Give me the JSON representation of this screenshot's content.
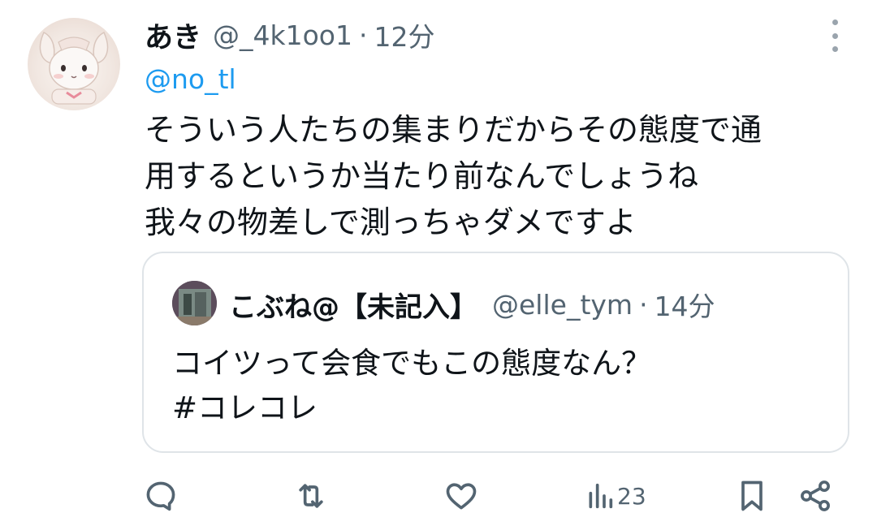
{
  "tweet": {
    "display_name": "あき",
    "handle": "@_4k1oo1",
    "separator": "·",
    "time": "12分",
    "reply_to": "@no_tl",
    "lines": [
      "そういう人たちの集まりだからその態度で通",
      "用するというか当たり前なんでしょうね",
      "我々の物差しで測っちゃダメですよ"
    ]
  },
  "quote": {
    "display_name": "こぶね@【未記入】",
    "handle": "@elle_tym",
    "separator": "·",
    "time": "14分",
    "lines": [
      "コイツって会食でもこの態度なん？",
      "#コレコレ"
    ]
  },
  "actions": {
    "views_count": "23",
    "icons": [
      "reply-icon",
      "retweet-icon",
      "like-icon",
      "views-icon",
      "bookmark-icon",
      "share-icon"
    ]
  },
  "colors": {
    "text": "#0f1419",
    "secondary": "#536471",
    "link": "#1d9bf0",
    "border": "#dfe4e8"
  }
}
